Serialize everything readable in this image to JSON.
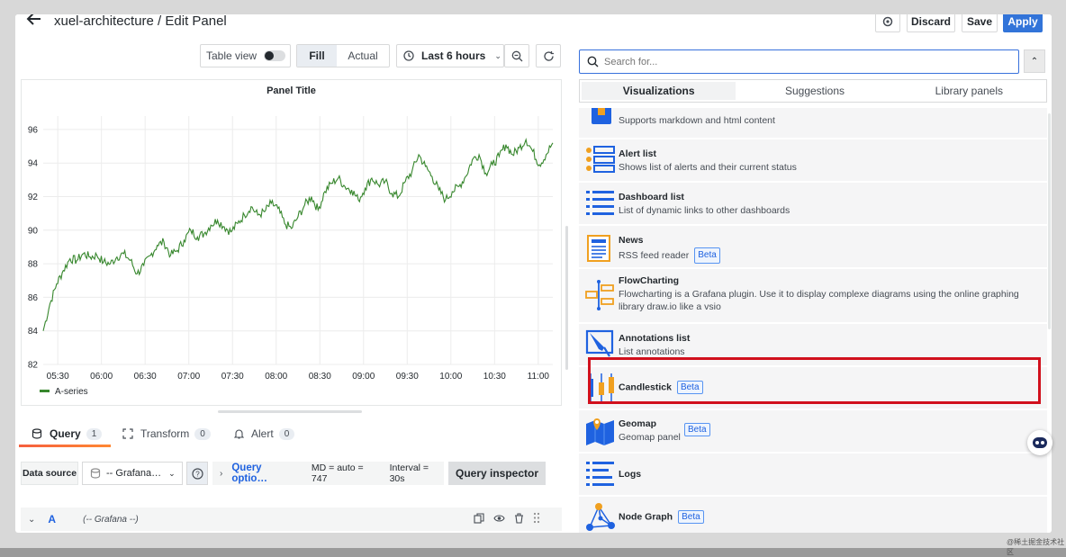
{
  "header": {
    "title": "xuel-architecture / Edit Panel",
    "discard_label": "Discard",
    "save_label": "Save",
    "apply_label": "Apply"
  },
  "toolbar": {
    "table_view_label": "Table view",
    "fill_label": "Fill",
    "actual_label": "Actual",
    "time_range": "Last 6 hours"
  },
  "panel": {
    "title": "Panel Title",
    "legend": "A-series"
  },
  "chart_data": {
    "type": "line",
    "x_ticks": [
      "05:30",
      "06:00",
      "06:30",
      "07:00",
      "07:30",
      "08:00",
      "08:30",
      "09:00",
      "09:30",
      "10:00",
      "10:30",
      "11:00"
    ],
    "y_ticks": [
      82,
      84,
      86,
      88,
      90,
      92,
      94,
      96
    ],
    "ylim": [
      82,
      96.8
    ],
    "series": [
      {
        "name": "A-series",
        "color": "#37872d",
        "x_range": [
          "05:20",
          "11:10"
        ],
        "values": [
          84.0,
          85.6,
          86.8,
          87.6,
          88.3,
          88.2,
          88.6,
          88.4,
          88.5,
          88.1,
          88.0,
          88.4,
          88.6,
          88.2,
          87.4,
          87.9,
          88.5,
          89.1,
          89.3,
          88.5,
          88.8,
          89.4,
          90.0,
          89.6,
          89.8,
          90.3,
          90.6,
          90.2,
          89.9,
          90.4,
          90.9,
          91.4,
          90.9,
          91.1,
          91.6,
          91.3,
          90.4,
          90.1,
          90.8,
          91.5,
          92.0,
          91.2,
          92.3,
          92.8,
          93.1,
          92.6,
          92.4,
          91.8,
          92.5,
          93.1,
          92.7,
          92.9,
          92.2,
          92.0,
          92.9,
          93.5,
          94.5,
          93.8,
          93.2,
          92.4,
          91.8,
          92.3,
          92.6,
          93.2,
          94.2,
          94.5,
          93.4,
          93.9,
          94.4,
          95.1,
          94.5,
          94.9,
          95.4,
          94.7,
          93.9,
          94.5,
          95.2
        ]
      }
    ]
  },
  "query_tabs": [
    {
      "label": "Query",
      "count": "1"
    },
    {
      "label": "Transform",
      "count": "0"
    },
    {
      "label": "Alert",
      "count": "0"
    }
  ],
  "query": {
    "data_source_label": "Data source",
    "data_source_value": "-- Grafana…",
    "options_label": "Query optio…",
    "md_text": "MD = auto = 747",
    "interval_text": "Interval = 30s",
    "inspector_label": "Query inspector",
    "row_ref": "A",
    "row_source": "(-- Grafana --)"
  },
  "search": {
    "placeholder": "Search for..."
  },
  "viz_tabs": [
    "Visualizations",
    "Suggestions",
    "Library panels"
  ],
  "visualizations": [
    {
      "name": "",
      "desc": "Supports markdown and html content",
      "beta": "",
      "icon": "text-icon"
    },
    {
      "name": "Alert list",
      "desc": "Shows list of alerts and their current status",
      "beta": "",
      "icon": "alert-list-icon"
    },
    {
      "name": "Dashboard list",
      "desc": "List of dynamic links to other dashboards",
      "beta": "",
      "icon": "dashboard-list-icon"
    },
    {
      "name": "News",
      "desc": "RSS feed reader",
      "beta": "Beta",
      "icon": "news-icon"
    },
    {
      "name": "FlowCharting",
      "desc": "Flowcharting is a Grafana plugin. Use it to display complexe diagrams using the online graphing library draw.io like a vsio",
      "beta": "",
      "icon": "flowcharting-icon"
    },
    {
      "name": "Annotations list",
      "desc": "List annotations",
      "beta": "",
      "icon": "annotations-list-icon"
    },
    {
      "name": "Candlestick",
      "desc": "",
      "beta": "Beta",
      "icon": "candlestick-icon"
    },
    {
      "name": "Geomap",
      "desc": "Geomap panel",
      "beta": "Beta",
      "icon": "geomap-icon"
    },
    {
      "name": "Logs",
      "desc": "",
      "beta": "",
      "icon": "logs-icon"
    },
    {
      "name": "Node Graph",
      "desc": "",
      "beta": "Beta",
      "icon": "node-graph-icon"
    }
  ],
  "watermark": "@稀土掘金技术社区",
  "colors": {
    "primary": "#3274d9",
    "series": "#37872d",
    "highlight": "#d1101d"
  }
}
